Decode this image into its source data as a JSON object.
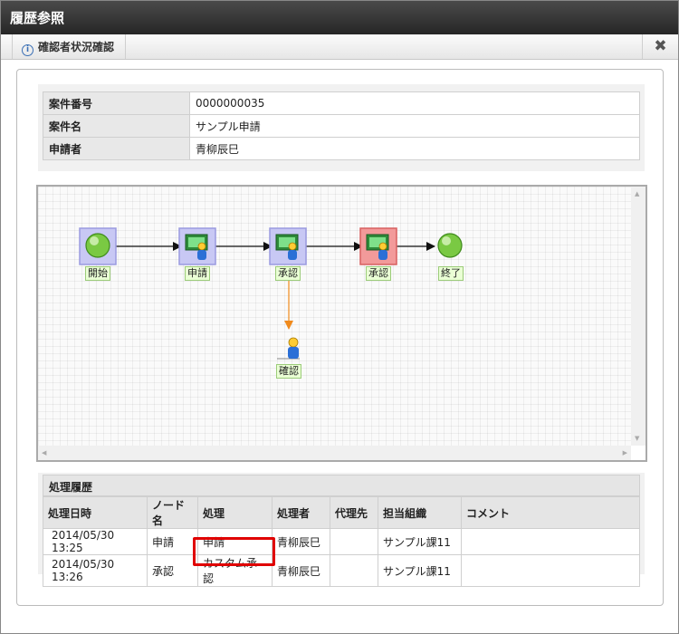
{
  "window": {
    "title": "履歴参照"
  },
  "toolbar": {
    "tab_label": "確認者状況確認",
    "close_symbol": "✖"
  },
  "case_info": {
    "rows": [
      {
        "label": "案件番号",
        "value": "0000000035"
      },
      {
        "label": "案件名",
        "value": "サンプル申請"
      },
      {
        "label": "申請者",
        "value": "青柳辰巳"
      }
    ]
  },
  "flow": {
    "nodes": [
      {
        "label": "開始",
        "type": "start",
        "state": "done"
      },
      {
        "label": "申請",
        "type": "user-task",
        "state": "done"
      },
      {
        "label": "承認",
        "type": "user-task",
        "state": "done"
      },
      {
        "label": "承認",
        "type": "user-task",
        "state": "active"
      },
      {
        "label": "終了",
        "type": "end",
        "state": "pending"
      },
      {
        "label": "確認",
        "type": "confirm",
        "state": "pending"
      }
    ],
    "colors": {
      "done": "#b7b7f0",
      "active": "#f28a8a",
      "flow_line": "#111111",
      "confirm_line": "#f08a1c"
    }
  },
  "history": {
    "title": "処理履歴",
    "columns": [
      "処理日時",
      "ノード名",
      "処理",
      "処理者",
      "代理先",
      "担当組織",
      "コメント"
    ],
    "rows": [
      [
        "2014/05/30 13:25",
        "申請",
        "申請",
        "青柳辰巳",
        "",
        "サンプル課11",
        ""
      ],
      [
        "2014/05/30 13:26",
        "承認",
        "カスタム承認",
        "青柳辰巳",
        "",
        "サンプル課11",
        ""
      ]
    ],
    "highlight_color": "#e00000"
  }
}
